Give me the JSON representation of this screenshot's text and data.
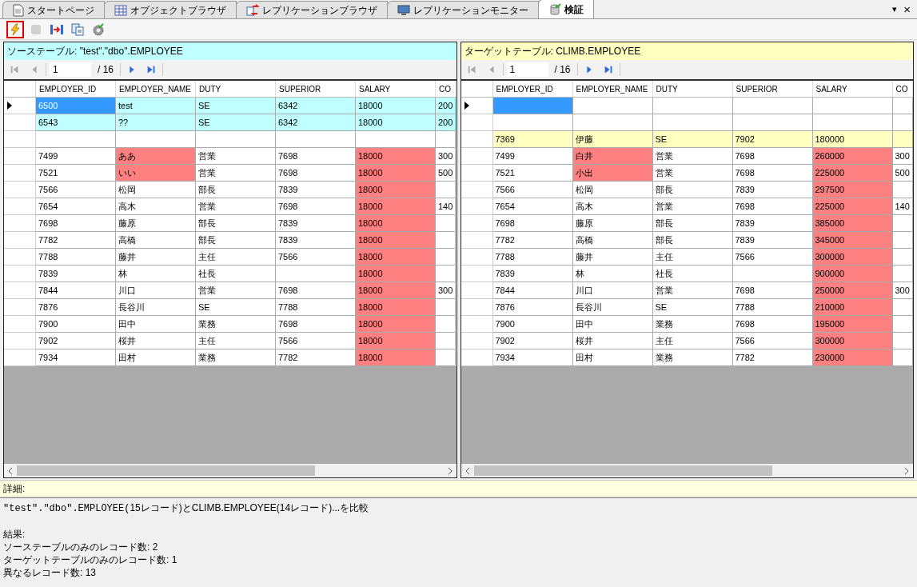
{
  "tabs": [
    {
      "label": "スタートページ",
      "kind": "page",
      "selected": false
    },
    {
      "label": "オブジェクトブラウザ",
      "kind": "grid",
      "selected": false
    },
    {
      "label": "レプリケーションブラウザ",
      "kind": "repl",
      "selected": false
    },
    {
      "label": "レプリケーションモニター",
      "kind": "monitor",
      "selected": false
    },
    {
      "label": "検証",
      "kind": "db",
      "selected": true
    }
  ],
  "tab_strip_controls": [
    "▾",
    "×"
  ],
  "toolbar": [
    {
      "kind": "run",
      "highlighted": true,
      "disabled": false
    },
    {
      "kind": "stop",
      "highlighted": false,
      "disabled": true
    },
    {
      "kind": "compare",
      "highlighted": false,
      "disabled": false
    },
    {
      "kind": "copy",
      "highlighted": false,
      "disabled": false
    },
    {
      "kind": "settings",
      "highlighted": false,
      "disabled": false
    }
  ],
  "panels": [
    {
      "kind": "source",
      "title": "ソーステーブル: \"test\".\"dbo\".EMPLOYEE",
      "pager": {
        "page": "1",
        "total": "/ 16"
      },
      "columns": [
        "EMPLOYER_ID",
        "EMPLOYER_NAME",
        "DUTY",
        "SUPERIOR",
        "SALARY",
        "CO"
      ],
      "rows": [
        {
          "kind": "source_only",
          "current": true,
          "cells": [
            {
              "text": "6500",
              "diff": false,
              "selected": true
            },
            {
              "text": "test",
              "diff": false,
              "selected": false
            },
            {
              "text": "SE",
              "diff": false,
              "selected": false
            },
            {
              "text": "6342",
              "diff": false,
              "selected": false
            },
            {
              "text": "18000",
              "diff": false,
              "selected": false
            },
            {
              "text": "200",
              "diff": false,
              "selected": false
            }
          ]
        },
        {
          "kind": "source_only",
          "current": false,
          "cells": [
            {
              "text": "6543",
              "diff": false,
              "selected": false
            },
            {
              "text": "??",
              "diff": false,
              "selected": false
            },
            {
              "text": "SE",
              "diff": false,
              "selected": false
            },
            {
              "text": "6342",
              "diff": false,
              "selected": false
            },
            {
              "text": "18000",
              "diff": false,
              "selected": false
            },
            {
              "text": "200",
              "diff": false,
              "selected": false
            }
          ]
        },
        {
          "kind": "blank",
          "current": false,
          "cells": []
        },
        {
          "kind": "normal",
          "current": false,
          "cells": [
            {
              "text": "7499",
              "diff": false,
              "selected": false
            },
            {
              "text": "ああ",
              "diff": true,
              "selected": false
            },
            {
              "text": "営業",
              "diff": false,
              "selected": false
            },
            {
              "text": "7698",
              "diff": false,
              "selected": false
            },
            {
              "text": "18000",
              "diff": true,
              "selected": false
            },
            {
              "text": "300",
              "diff": false,
              "selected": false
            }
          ]
        },
        {
          "kind": "normal",
          "current": false,
          "cells": [
            {
              "text": "7521",
              "diff": false,
              "selected": false
            },
            {
              "text": "いい",
              "diff": true,
              "selected": false
            },
            {
              "text": "営業",
              "diff": false,
              "selected": false
            },
            {
              "text": "7698",
              "diff": false,
              "selected": false
            },
            {
              "text": "18000",
              "diff": true,
              "selected": false
            },
            {
              "text": "500",
              "diff": false,
              "selected": false
            }
          ]
        },
        {
          "kind": "normal",
          "current": false,
          "cells": [
            {
              "text": "7566",
              "diff": false,
              "selected": false
            },
            {
              "text": "松岡",
              "diff": false,
              "selected": false
            },
            {
              "text": "部長",
              "diff": false,
              "selected": false
            },
            {
              "text": "7839",
              "diff": false,
              "selected": false
            },
            {
              "text": "18000",
              "diff": true,
              "selected": false
            },
            {
              "diff": false,
              "selected": false
            }
          ]
        },
        {
          "kind": "normal",
          "current": false,
          "cells": [
            {
              "text": "7654",
              "diff": false,
              "selected": false
            },
            {
              "text": "高木",
              "diff": false,
              "selected": false
            },
            {
              "text": "営業",
              "diff": false,
              "selected": false
            },
            {
              "text": "7698",
              "diff": false,
              "selected": false
            },
            {
              "text": "18000",
              "diff": true,
              "selected": false
            },
            {
              "text": "140",
              "diff": false,
              "selected": false
            }
          ]
        },
        {
          "kind": "normal",
          "current": false,
          "cells": [
            {
              "text": "7698",
              "diff": false,
              "selected": false
            },
            {
              "text": "藤原",
              "diff": false,
              "selected": false
            },
            {
              "text": "部長",
              "diff": false,
              "selected": false
            },
            {
              "text": "7839",
              "diff": false,
              "selected": false
            },
            {
              "text": "18000",
              "diff": true,
              "selected": false
            },
            {
              "diff": false,
              "selected": false
            }
          ]
        },
        {
          "kind": "normal",
          "current": false,
          "cells": [
            {
              "text": "7782",
              "diff": false,
              "selected": false
            },
            {
              "text": "高橋",
              "diff": false,
              "selected": false
            },
            {
              "text": "部長",
              "diff": false,
              "selected": false
            },
            {
              "text": "7839",
              "diff": false,
              "selected": false
            },
            {
              "text": "18000",
              "diff": true,
              "selected": false
            },
            {
              "diff": false,
              "selected": false
            }
          ]
        },
        {
          "kind": "normal",
          "current": false,
          "cells": [
            {
              "text": "7788",
              "diff": false,
              "selected": false
            },
            {
              "text": "藤井",
              "diff": false,
              "selected": false
            },
            {
              "text": "主任",
              "diff": false,
              "selected": false
            },
            {
              "text": "7566",
              "diff": false,
              "selected": false
            },
            {
              "text": "18000",
              "diff": true,
              "selected": false
            },
            {
              "diff": false,
              "selected": false
            }
          ]
        },
        {
          "kind": "normal",
          "current": false,
          "cells": [
            {
              "text": "7839",
              "diff": false,
              "selected": false
            },
            {
              "text": "林",
              "diff": false,
              "selected": false
            },
            {
              "text": "社長",
              "diff": false,
              "selected": false
            },
            {
              "diff": false,
              "selected": false
            },
            {
              "text": "18000",
              "diff": true,
              "selected": false
            },
            {
              "diff": false,
              "selected": false
            }
          ]
        },
        {
          "kind": "normal",
          "current": false,
          "cells": [
            {
              "text": "7844",
              "diff": false,
              "selected": false
            },
            {
              "text": "川口",
              "diff": false,
              "selected": false
            },
            {
              "text": "営業",
              "diff": false,
              "selected": false
            },
            {
              "text": "7698",
              "diff": false,
              "selected": false
            },
            {
              "text": "18000",
              "diff": true,
              "selected": false
            },
            {
              "text": "300",
              "diff": false,
              "selected": false
            }
          ]
        },
        {
          "kind": "normal",
          "current": false,
          "cells": [
            {
              "text": "7876",
              "diff": false,
              "selected": false
            },
            {
              "text": "長谷川",
              "diff": false,
              "selected": false
            },
            {
              "text": "SE",
              "diff": false,
              "selected": false
            },
            {
              "text": "7788",
              "diff": false,
              "selected": false
            },
            {
              "text": "18000",
              "diff": true,
              "selected": false
            },
            {
              "diff": false,
              "selected": false
            }
          ]
        },
        {
          "kind": "normal",
          "current": false,
          "cells": [
            {
              "text": "7900",
              "diff": false,
              "selected": false
            },
            {
              "text": "田中",
              "diff": false,
              "selected": false
            },
            {
              "text": "業務",
              "diff": false,
              "selected": false
            },
            {
              "text": "7698",
              "diff": false,
              "selected": false
            },
            {
              "text": "18000",
              "diff": true,
              "selected": false
            },
            {
              "diff": false,
              "selected": false
            }
          ]
        },
        {
          "kind": "normal",
          "current": false,
          "cells": [
            {
              "text": "7902",
              "diff": false,
              "selected": false
            },
            {
              "text": "桜井",
              "diff": false,
              "selected": false
            },
            {
              "text": "主任",
              "diff": false,
              "selected": false
            },
            {
              "text": "7566",
              "diff": false,
              "selected": false
            },
            {
              "text": "18000",
              "diff": true,
              "selected": false
            },
            {
              "diff": false,
              "selected": false
            }
          ]
        },
        {
          "kind": "normal",
          "current": false,
          "cells": [
            {
              "text": "7934",
              "diff": false,
              "selected": false
            },
            {
              "text": "田村",
              "diff": false,
              "selected": false
            },
            {
              "text": "業務",
              "diff": false,
              "selected": false
            },
            {
              "text": "7782",
              "diff": false,
              "selected": false
            },
            {
              "text": "18000",
              "diff": true,
              "selected": false
            },
            {
              "diff": false,
              "selected": false
            }
          ]
        }
      ]
    },
    {
      "kind": "target",
      "title": "ターゲットテーブル: CLIMB.EMPLOYEE",
      "pager": {
        "page": "1",
        "total": "/ 16"
      },
      "columns": [
        "EMPLOYER_ID",
        "EMPLOYER_NAME",
        "DUTY",
        "SUPERIOR",
        "SALARY",
        "CO"
      ],
      "rows": [
        {
          "kind": "blank",
          "current": true,
          "cells": [
            {
              "diff": false,
              "selected": true
            },
            {
              "diff": false,
              "selected": false
            },
            {
              "diff": false,
              "selected": false
            },
            {
              "diff": false,
              "selected": false
            },
            {
              "diff": false,
              "selected": false
            },
            {
              "diff": false,
              "selected": false
            }
          ]
        },
        {
          "kind": "blank",
          "current": false,
          "cells": []
        },
        {
          "kind": "target_only",
          "current": false,
          "cells": [
            {
              "text": "7369",
              "diff": false,
              "selected": false
            },
            {
              "text": "伊藤",
              "diff": false,
              "selected": false
            },
            {
              "text": "SE",
              "diff": false,
              "selected": false
            },
            {
              "text": "7902",
              "diff": false,
              "selected": false
            },
            {
              "text": "180000",
              "diff": false,
              "selected": false
            },
            {
              "diff": false,
              "selected": false
            }
          ]
        },
        {
          "kind": "normal",
          "current": false,
          "cells": [
            {
              "text": "7499",
              "diff": false,
              "selected": false
            },
            {
              "text": "白井",
              "diff": true,
              "selected": false
            },
            {
              "text": "営業",
              "diff": false,
              "selected": false
            },
            {
              "text": "7698",
              "diff": false,
              "selected": false
            },
            {
              "text": "260000",
              "diff": true,
              "selected": false
            },
            {
              "text": "300",
              "diff": false,
              "selected": false
            }
          ]
        },
        {
          "kind": "normal",
          "current": false,
          "cells": [
            {
              "text": "7521",
              "diff": false,
              "selected": false
            },
            {
              "text": "小出",
              "diff": true,
              "selected": false
            },
            {
              "text": "営業",
              "diff": false,
              "selected": false
            },
            {
              "text": "7698",
              "diff": false,
              "selected": false
            },
            {
              "text": "225000",
              "diff": true,
              "selected": false
            },
            {
              "text": "500",
              "diff": false,
              "selected": false
            }
          ]
        },
        {
          "kind": "normal",
          "current": false,
          "cells": [
            {
              "text": "7566",
              "diff": false,
              "selected": false
            },
            {
              "text": "松岡",
              "diff": false,
              "selected": false
            },
            {
              "text": "部長",
              "diff": false,
              "selected": false
            },
            {
              "text": "7839",
              "diff": false,
              "selected": false
            },
            {
              "text": "297500",
              "diff": true,
              "selected": false
            },
            {
              "diff": false,
              "selected": false
            }
          ]
        },
        {
          "kind": "normal",
          "current": false,
          "cells": [
            {
              "text": "7654",
              "diff": false,
              "selected": false
            },
            {
              "text": "高木",
              "diff": false,
              "selected": false
            },
            {
              "text": "営業",
              "diff": false,
              "selected": false
            },
            {
              "text": "7698",
              "diff": false,
              "selected": false
            },
            {
              "text": "225000",
              "diff": true,
              "selected": false
            },
            {
              "text": "140",
              "diff": false,
              "selected": false
            }
          ]
        },
        {
          "kind": "normal",
          "current": false,
          "cells": [
            {
              "text": "7698",
              "diff": false,
              "selected": false
            },
            {
              "text": "藤原",
              "diff": false,
              "selected": false
            },
            {
              "text": "部長",
              "diff": false,
              "selected": false
            },
            {
              "text": "7839",
              "diff": false,
              "selected": false
            },
            {
              "text": "385000",
              "diff": true,
              "selected": false
            },
            {
              "diff": false,
              "selected": false
            }
          ]
        },
        {
          "kind": "normal",
          "current": false,
          "cells": [
            {
              "text": "7782",
              "diff": false,
              "selected": false
            },
            {
              "text": "高橋",
              "diff": false,
              "selected": false
            },
            {
              "text": "部長",
              "diff": false,
              "selected": false
            },
            {
              "text": "7839",
              "diff": false,
              "selected": false
            },
            {
              "text": "345000",
              "diff": true,
              "selected": false
            },
            {
              "diff": false,
              "selected": false
            }
          ]
        },
        {
          "kind": "normal",
          "current": false,
          "cells": [
            {
              "text": "7788",
              "diff": false,
              "selected": false
            },
            {
              "text": "藤井",
              "diff": false,
              "selected": false
            },
            {
              "text": "主任",
              "diff": false,
              "selected": false
            },
            {
              "text": "7566",
              "diff": false,
              "selected": false
            },
            {
              "text": "300000",
              "diff": true,
              "selected": false
            },
            {
              "diff": false,
              "selected": false
            }
          ]
        },
        {
          "kind": "normal",
          "current": false,
          "cells": [
            {
              "text": "7839",
              "diff": false,
              "selected": false
            },
            {
              "text": "林",
              "diff": false,
              "selected": false
            },
            {
              "text": "社長",
              "diff": false,
              "selected": false
            },
            {
              "diff": false,
              "selected": false
            },
            {
              "text": "900000",
              "diff": true,
              "selected": false
            },
            {
              "diff": false,
              "selected": false
            }
          ]
        },
        {
          "kind": "normal",
          "current": false,
          "cells": [
            {
              "text": "7844",
              "diff": false,
              "selected": false
            },
            {
              "text": "川口",
              "diff": false,
              "selected": false
            },
            {
              "text": "営業",
              "diff": false,
              "selected": false
            },
            {
              "text": "7698",
              "diff": false,
              "selected": false
            },
            {
              "text": "250000",
              "diff": true,
              "selected": false
            },
            {
              "text": "300",
              "diff": false,
              "selected": false
            }
          ]
        },
        {
          "kind": "normal",
          "current": false,
          "cells": [
            {
              "text": "7876",
              "diff": false,
              "selected": false
            },
            {
              "text": "長谷川",
              "diff": false,
              "selected": false
            },
            {
              "text": "SE",
              "diff": false,
              "selected": false
            },
            {
              "text": "7788",
              "diff": false,
              "selected": false
            },
            {
              "text": "210000",
              "diff": true,
              "selected": false
            },
            {
              "diff": false,
              "selected": false
            }
          ]
        },
        {
          "kind": "normal",
          "current": false,
          "cells": [
            {
              "text": "7900",
              "diff": false,
              "selected": false
            },
            {
              "text": "田中",
              "diff": false,
              "selected": false
            },
            {
              "text": "業務",
              "diff": false,
              "selected": false
            },
            {
              "text": "7698",
              "diff": false,
              "selected": false
            },
            {
              "text": "195000",
              "diff": true,
              "selected": false
            },
            {
              "diff": false,
              "selected": false
            }
          ]
        },
        {
          "kind": "normal",
          "current": false,
          "cells": [
            {
              "text": "7902",
              "diff": false,
              "selected": false
            },
            {
              "text": "桜井",
              "diff": false,
              "selected": false
            },
            {
              "text": "主任",
              "diff": false,
              "selected": false
            },
            {
              "text": "7566",
              "diff": false,
              "selected": false
            },
            {
              "text": "300000",
              "diff": true,
              "selected": false
            },
            {
              "diff": false,
              "selected": false
            }
          ]
        },
        {
          "kind": "normal",
          "current": false,
          "cells": [
            {
              "text": "7934",
              "diff": false,
              "selected": false
            },
            {
              "text": "田村",
              "diff": false,
              "selected": false
            },
            {
              "text": "業務",
              "diff": false,
              "selected": false
            },
            {
              "text": "7782",
              "diff": false,
              "selected": false
            },
            {
              "text": "230000",
              "diff": true,
              "selected": false
            },
            {
              "diff": false,
              "selected": false
            }
          ]
        }
      ]
    }
  ],
  "details": {
    "label": "詳細:",
    "summary": {
      "code": "\"test\".\"dbo\".EMPLOYEE(",
      "text": "15レコード)とCLIMB.EMPLOYEE(14レコード)...を比較"
    },
    "lines": [
      "結果:",
      "ソーステーブルのみのレコード数: 2",
      "ターゲットテーブルのみのレコード数: 1",
      "異なるレコード数: 13"
    ]
  }
}
